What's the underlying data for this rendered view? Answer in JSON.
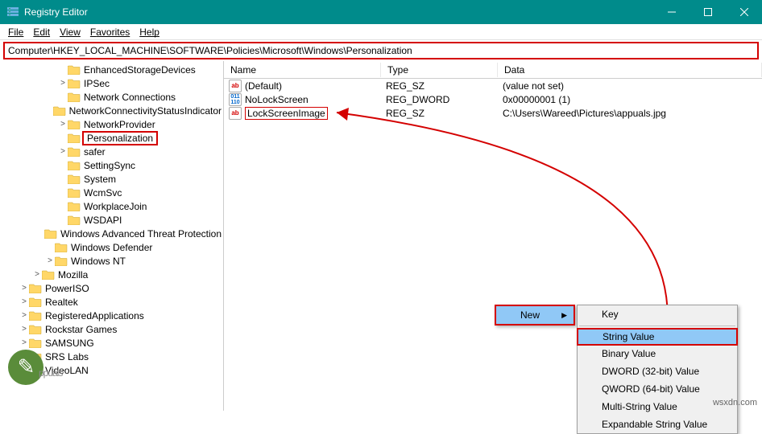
{
  "window": {
    "title": "Registry Editor"
  },
  "menubar": {
    "file": "File",
    "edit": "Edit",
    "view": "View",
    "favorites": "Favorites",
    "help": "Help"
  },
  "address": "Computer\\HKEY_LOCAL_MACHINE\\SOFTWARE\\Policies\\Microsoft\\Windows\\Personalization",
  "tree": [
    {
      "indent": 72,
      "exp": "",
      "label": "EnhancedStorageDevices"
    },
    {
      "indent": 72,
      "exp": ">",
      "label": "IPSec"
    },
    {
      "indent": 72,
      "exp": "",
      "label": "Network Connections"
    },
    {
      "indent": 72,
      "exp": "",
      "label": "NetworkConnectivityStatusIndicator"
    },
    {
      "indent": 72,
      "exp": ">",
      "label": "NetworkProvider"
    },
    {
      "indent": 72,
      "exp": "",
      "label": "Personalization",
      "selected": true
    },
    {
      "indent": 72,
      "exp": ">",
      "label": "safer"
    },
    {
      "indent": 72,
      "exp": "",
      "label": "SettingSync"
    },
    {
      "indent": 72,
      "exp": "",
      "label": "System"
    },
    {
      "indent": 72,
      "exp": "",
      "label": "WcmSvc"
    },
    {
      "indent": 72,
      "exp": "",
      "label": "WorkplaceJoin"
    },
    {
      "indent": 72,
      "exp": "",
      "label": "WSDAPI"
    },
    {
      "indent": 56,
      "exp": "",
      "label": "Windows Advanced Threat Protection"
    },
    {
      "indent": 56,
      "exp": "",
      "label": "Windows Defender"
    },
    {
      "indent": 56,
      "exp": ">",
      "label": "Windows NT"
    },
    {
      "indent": 40,
      "exp": ">",
      "label": "Mozilla"
    },
    {
      "indent": 24,
      "exp": ">",
      "label": "PowerISO"
    },
    {
      "indent": 24,
      "exp": ">",
      "label": "Realtek"
    },
    {
      "indent": 24,
      "exp": ">",
      "label": "RegisteredApplications"
    },
    {
      "indent": 24,
      "exp": ">",
      "label": "Rockstar Games"
    },
    {
      "indent": 24,
      "exp": ">",
      "label": "SAMSUNG"
    },
    {
      "indent": 24,
      "exp": ">",
      "label": "SRS Labs"
    },
    {
      "indent": 24,
      "exp": ">",
      "label": "VideoLAN"
    }
  ],
  "columns": {
    "name": "Name",
    "type": "Type",
    "data": "Data"
  },
  "values": [
    {
      "icon": "ab",
      "name": "(Default)",
      "type": "REG_SZ",
      "data": "(value not set)"
    },
    {
      "icon": "bin",
      "name": "NoLockScreen",
      "type": "REG_DWORD",
      "data": "0x00000001 (1)"
    },
    {
      "icon": "ab",
      "name": "LockScreenImage",
      "type": "REG_SZ",
      "data": "C:\\Users\\Wareed\\Pictures\\appuals.jpg",
      "editing": true
    }
  ],
  "context": {
    "new": "New",
    "items": [
      "Key",
      "String Value",
      "Binary Value",
      "DWORD (32-bit) Value",
      "QWORD (64-bit) Value",
      "Multi-String Value",
      "Expandable String Value"
    ]
  },
  "watermark": "ppuals",
  "source": "wsxdn.com"
}
